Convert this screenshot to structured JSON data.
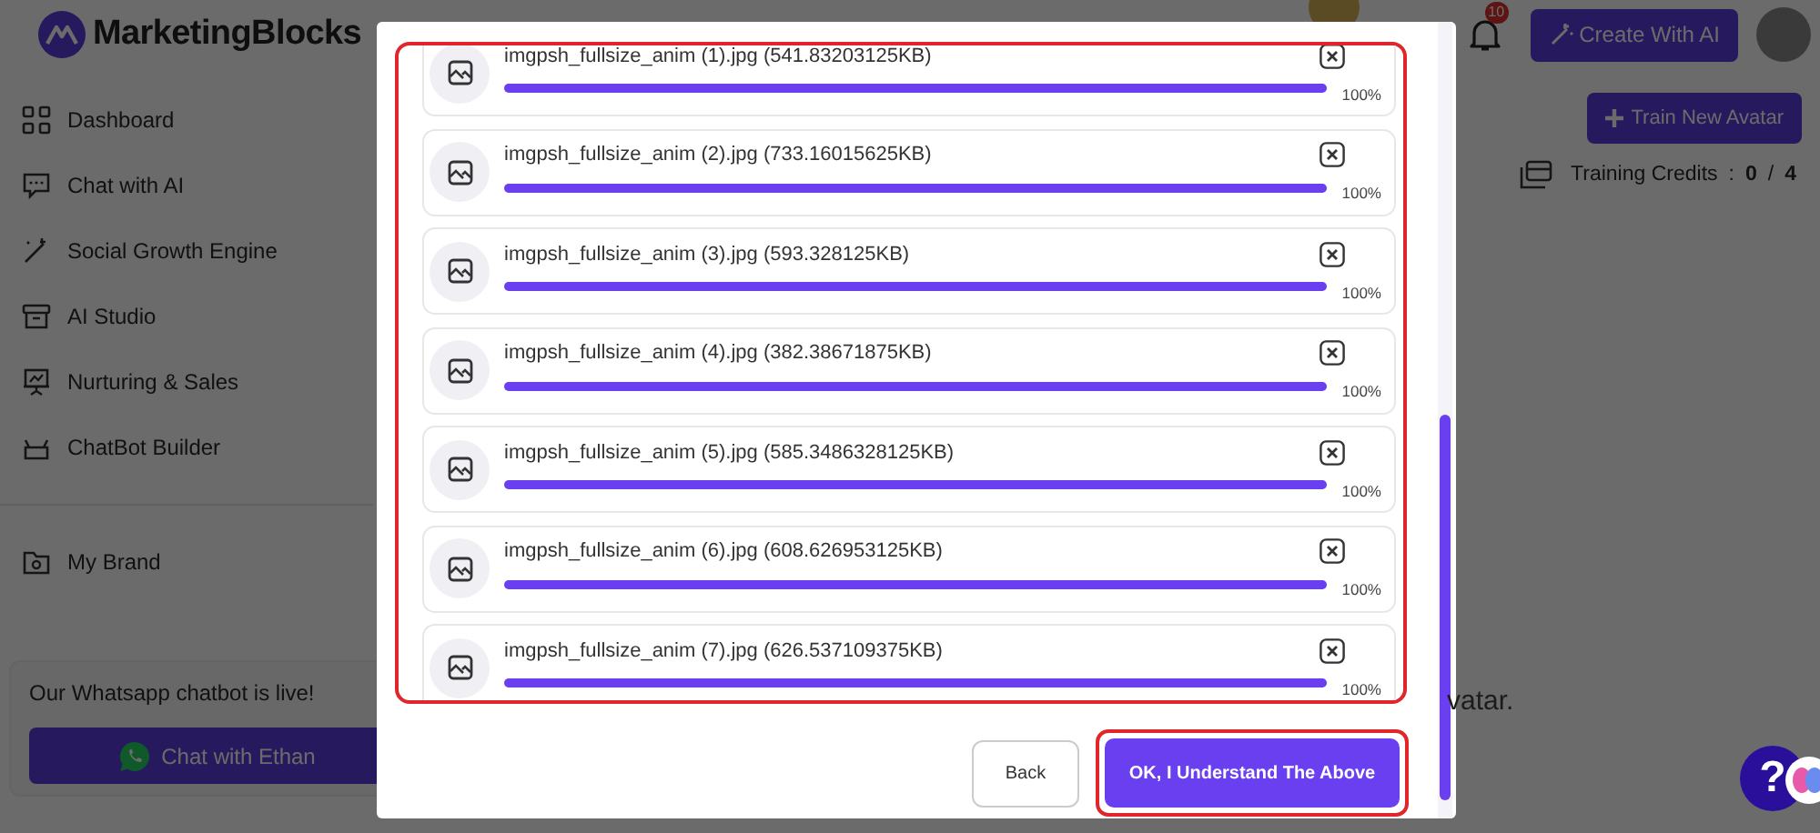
{
  "header": {
    "logo": "MarketingBlocks",
    "notification_count": "10",
    "create_button": "Create With AI"
  },
  "sidebar": {
    "groups": [
      {
        "items": [
          {
            "label": "Dashboard"
          },
          {
            "label": "Chat with AI"
          },
          {
            "label": "Social Growth Engine"
          },
          {
            "label": "AI Studio"
          },
          {
            "label": "Nurturing & Sales"
          },
          {
            "label": "ChatBot Builder"
          }
        ]
      },
      {
        "items": [
          {
            "label": "My Brand"
          }
        ]
      }
    ]
  },
  "promo": {
    "text": "Our Whatsapp chatbot is live!",
    "button": "Chat with Ethan"
  },
  "page": {
    "train_button": "Train New Avatar",
    "credits": {
      "label": "Training Credits",
      "separator": ":",
      "used": "0",
      "slash": "/",
      "total": "4"
    },
    "partial_text": "vatar."
  },
  "modal": {
    "files": [
      {
        "name": "imgpsh_fullsize_anim (1).jpg (541.83203125KB)",
        "level": 1,
        "reading": "100%"
      },
      {
        "name": "imgpsh_fullsize_anim (2).jpg (733.16015625KB)",
        "level": 1,
        "reading": "100%"
      },
      {
        "name": "imgpsh_fullsize_anim (3).jpg (593.328125KB)",
        "level": 1,
        "reading": "100%"
      },
      {
        "name": "imgpsh_fullsize_anim (4).jpg (382.38671875KB)",
        "level": 1,
        "reading": "100%"
      },
      {
        "name": "imgpsh_fullsize_anim (5).jpg (585.3486328125KB)",
        "level": 1,
        "reading": "100%"
      },
      {
        "name": "imgpsh_fullsize_anim (6).jpg (608.626953125KB)",
        "level": 1,
        "reading": "100%"
      },
      {
        "name": "imgpsh_fullsize_anim (7).jpg (626.537109375KB)",
        "level": 1,
        "reading": "100%"
      }
    ],
    "back_button": "Back",
    "confirm_button": "OK, I Understand The Above"
  },
  "help_button": "?"
}
